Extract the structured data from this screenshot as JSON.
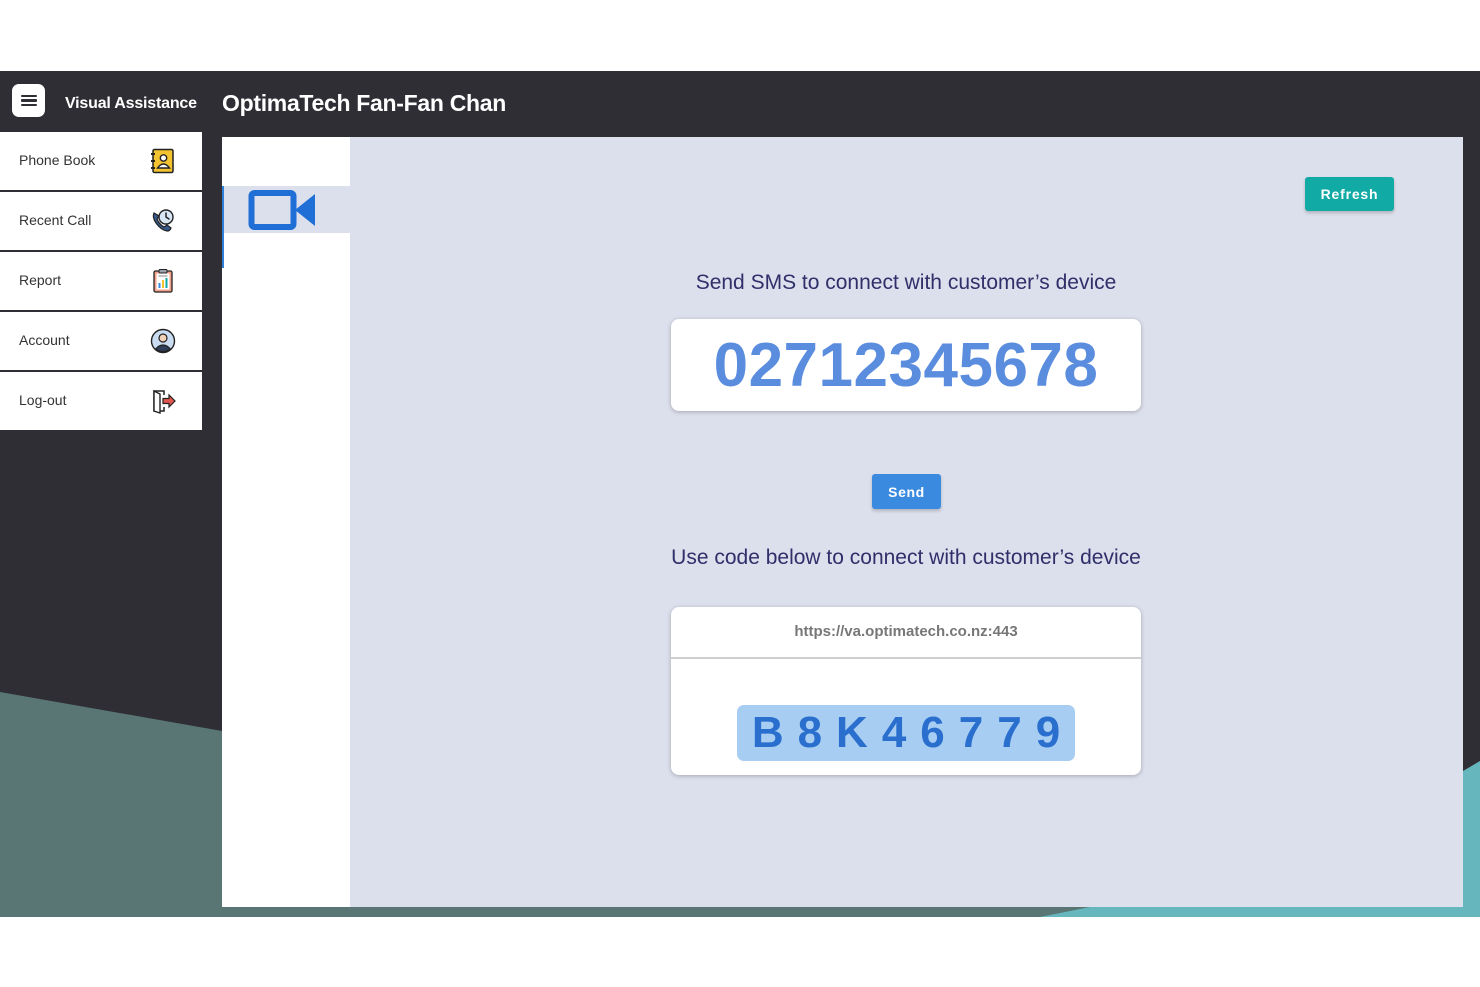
{
  "app": {
    "name": "Visual Assistance",
    "page_title": "OptimaTech Fan-Fan Chan",
    "menu_icon": "hamburger-menu-icon"
  },
  "sidebar": {
    "items": [
      {
        "label": "Phone Book",
        "icon": "phone-book-icon"
      },
      {
        "label": "Recent Call",
        "icon": "recent-call-icon"
      },
      {
        "label": "Report",
        "icon": "report-icon"
      },
      {
        "label": "Account",
        "icon": "account-icon"
      },
      {
        "label": "Log-out",
        "icon": "logout-icon"
      }
    ]
  },
  "tabs": [
    {
      "icon": "video-camera-icon",
      "active": true
    }
  ],
  "main": {
    "refresh_label": "Refresh",
    "sms_heading": "Send SMS to connect with customer’s device",
    "phone_number": "02712345678",
    "send_label": "Send",
    "code_heading": "Use code below to connect with customer’s device",
    "server_url": "https://va.optimatech.co.nz:443",
    "connect_code": "B8K46779"
  },
  "colors": {
    "topbar": "#2e2e34",
    "content_bg": "#dcdfec",
    "refresh_button": "#11aaa4",
    "send_button": "#3a8be0",
    "phone_number_text": "#5b8ddf",
    "code_box": "#a7cdf2",
    "code_text": "#2a6fce",
    "video_icon": "#1f6fd6"
  }
}
